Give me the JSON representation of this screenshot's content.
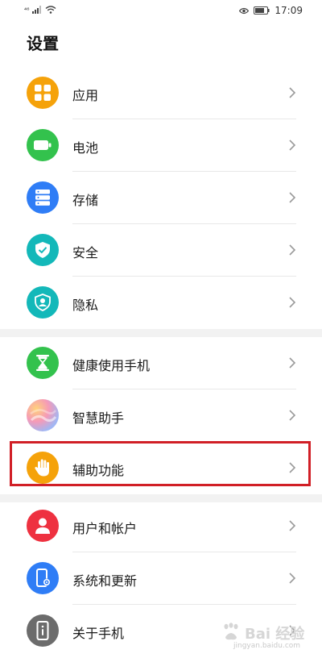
{
  "status_bar": {
    "signal_label": "⁴⁶",
    "time": "17:09"
  },
  "page": {
    "title": "设置"
  },
  "items": [
    {
      "label": "应用",
      "icon": "apps-icon",
      "color": "#f5a20a"
    },
    {
      "label": "电池",
      "icon": "battery-icon",
      "color": "#33c24d"
    },
    {
      "label": "存储",
      "icon": "storage-icon",
      "color": "#2f7df6"
    },
    {
      "label": "安全",
      "icon": "security-shield-icon",
      "color": "#13b8b9"
    },
    {
      "label": "隐私",
      "icon": "privacy-shield-icon",
      "color": "#13b8b9"
    },
    {
      "label": "健康使用手机",
      "icon": "hourglass-icon",
      "color": "#33c24d"
    },
    {
      "label": "智慧助手",
      "icon": "assistant-icon",
      "color": "#b79de8"
    },
    {
      "label": "辅助功能",
      "icon": "hand-icon",
      "color": "#f5a20a"
    },
    {
      "label": "用户和帐户",
      "icon": "user-icon",
      "color": "#ee3140"
    },
    {
      "label": "系统和更新",
      "icon": "system-update-icon",
      "color": "#2f7df6"
    },
    {
      "label": "关于手机",
      "icon": "phone-info-icon",
      "color": "#6c6c6c"
    }
  ],
  "highlight_color": "#d11f26",
  "watermark": {
    "main": "Bai 经验",
    "sub": "jingyan.baidu.com"
  }
}
